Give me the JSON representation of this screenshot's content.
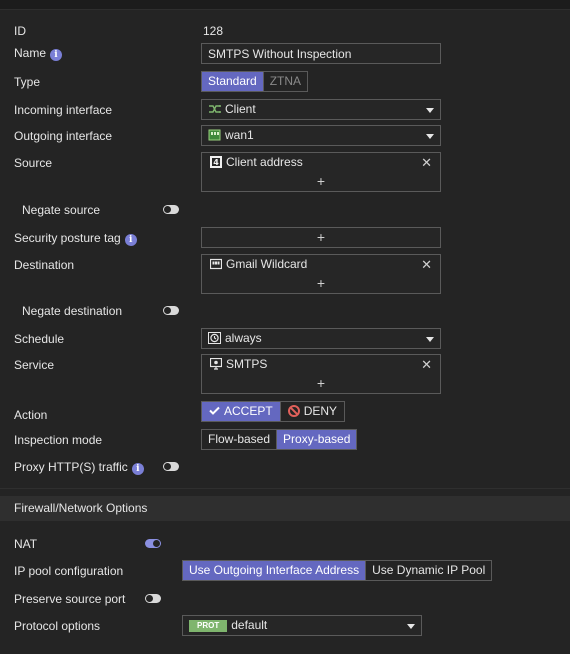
{
  "form": {
    "id_label": "ID",
    "id_value": "128",
    "name_label": "Name",
    "name_value": "SMTPS Without Inspection",
    "type_label": "Type",
    "type_options": [
      "Standard",
      "ZTNA"
    ],
    "incoming_label": "Incoming interface",
    "incoming_value": "Client",
    "outgoing_label": "Outgoing interface",
    "outgoing_value": "wan1",
    "source_label": "Source",
    "source_value": "Client address",
    "negate_source_label": "Negate source",
    "security_posture_label": "Security posture tag",
    "destination_label": "Destination",
    "destination_value": "Gmail Wildcard",
    "negate_destination_label": "Negate destination",
    "schedule_label": "Schedule",
    "schedule_value": "always",
    "service_label": "Service",
    "service_value": "SMTPS",
    "action_label": "Action",
    "action_accept": "ACCEPT",
    "action_deny": "DENY",
    "inspection_label": "Inspection mode",
    "inspection_options": [
      "Flow-based",
      "Proxy-based"
    ],
    "proxy_http_label": "Proxy HTTP(S) traffic",
    "add_symbol": "+",
    "remove_symbol": "✕",
    "info_symbol": "i"
  },
  "section": {
    "title": "Firewall/Network Options"
  },
  "network": {
    "nat_label": "NAT",
    "ip_pool_label": "IP pool configuration",
    "ip_pool_options": [
      "Use Outgoing Interface Address",
      "Use Dynamic IP Pool"
    ],
    "preserve_port_label": "Preserve source port",
    "protocol_label": "Protocol options",
    "protocol_tag": "PROT",
    "protocol_value": "default"
  },
  "icons": {
    "incoming": "zone-icon",
    "outgoing": "port-icon",
    "source": "address-icon",
    "destination": "fqdn-icon",
    "schedule": "clock-icon",
    "service": "service-icon"
  },
  "colors": {
    "accent": "#6468c0",
    "toggle_on": "#8a8fe0",
    "deny": "#e0605a",
    "tag": "#7fb56e"
  }
}
